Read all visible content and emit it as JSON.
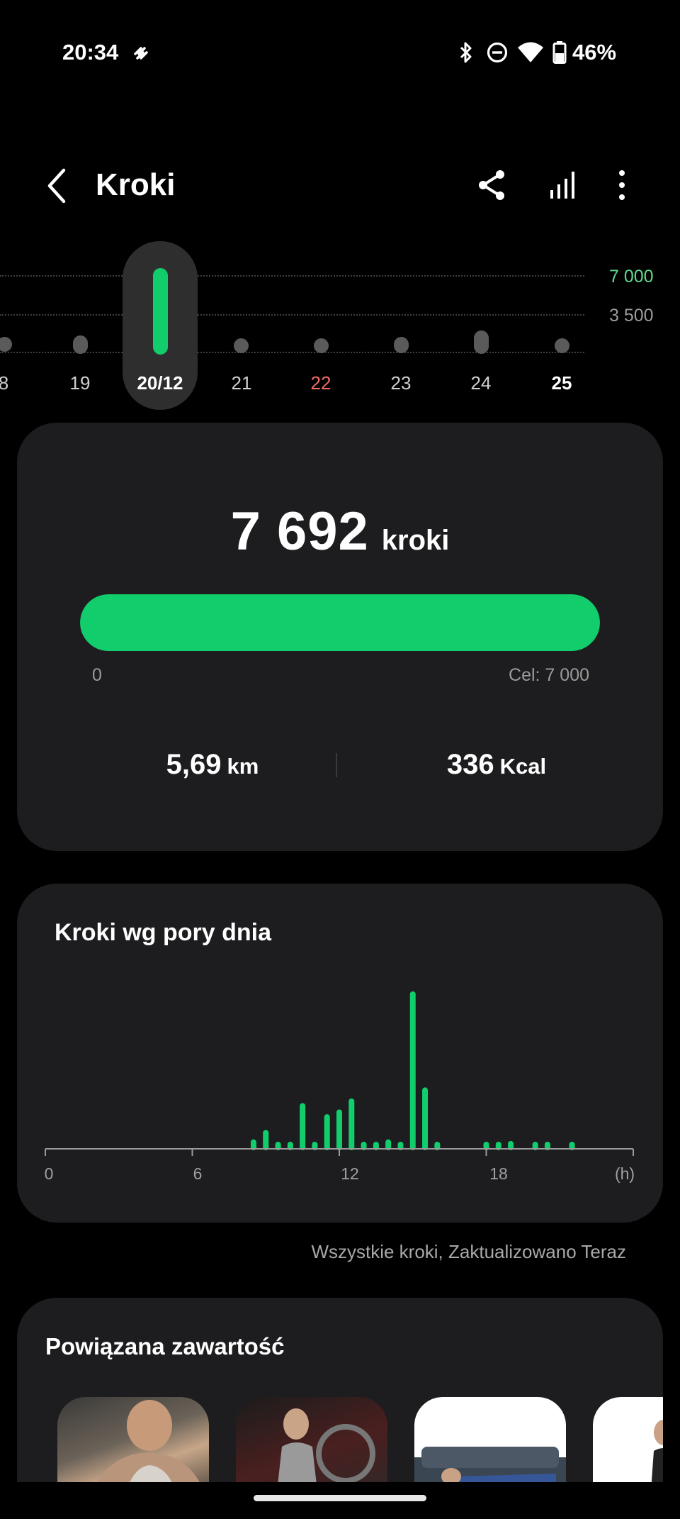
{
  "status_bar": {
    "time": "20:34",
    "battery_text": "46%",
    "icons": [
      "tide-icon",
      "bluetooth-icon",
      "dnd-icon",
      "wifi-icon",
      "battery-icon"
    ]
  },
  "header": {
    "title": "Kroki",
    "actions": [
      "share-icon",
      "trends-icon",
      "more-icon"
    ]
  },
  "week_strip": {
    "ref_high": "7 000",
    "ref_low": "3 500",
    "days": [
      {
        "label": "8"
      },
      {
        "label": "19"
      },
      {
        "label": "20/12"
      },
      {
        "label": "21"
      },
      {
        "label": "22"
      },
      {
        "label": "23"
      },
      {
        "label": "24"
      },
      {
        "label": "25"
      }
    ]
  },
  "summary": {
    "steps": "7 692",
    "steps_unit": "kroki",
    "progress_fraction": 1.0,
    "bar_min": "0",
    "goal_label": "Cel: 7 000",
    "distance": "5,69",
    "distance_unit": "km",
    "calories": "336",
    "calories_unit": "Kcal"
  },
  "hourly": {
    "title": "Kroki wg pory dnia",
    "x_ticks": [
      "0",
      "6",
      "12",
      "18"
    ],
    "x_unit": "(h)"
  },
  "chart_data": {
    "type": "bar",
    "title": "Kroki wg pory dnia",
    "xlabel": "(h)",
    "ylabel": "",
    "x_range": [
      0,
      24
    ],
    "tick_labels": [
      "0",
      "6",
      "12",
      "18"
    ],
    "grid": false,
    "relative_values": true,
    "x": [
      8.5,
      9.0,
      9.5,
      10.0,
      10.5,
      11.0,
      11.5,
      12.0,
      12.5,
      13.0,
      13.5,
      14.0,
      14.5,
      15.0,
      15.5,
      16.0,
      18.0,
      18.5,
      19.0,
      20.0,
      20.5,
      21.5
    ],
    "values": [
      0.06,
      0.12,
      0.04,
      0.04,
      0.29,
      0.04,
      0.22,
      0.25,
      0.32,
      0.04,
      0.04,
      0.06,
      0.04,
      1.0,
      0.39,
      0.04,
      0.04,
      0.04,
      0.05,
      0.04,
      0.04,
      0.04
    ]
  },
  "footnote": "Wszystkie kroki, Zaktualizowano Teraz",
  "related": {
    "title": "Powiązana zawartość"
  }
}
